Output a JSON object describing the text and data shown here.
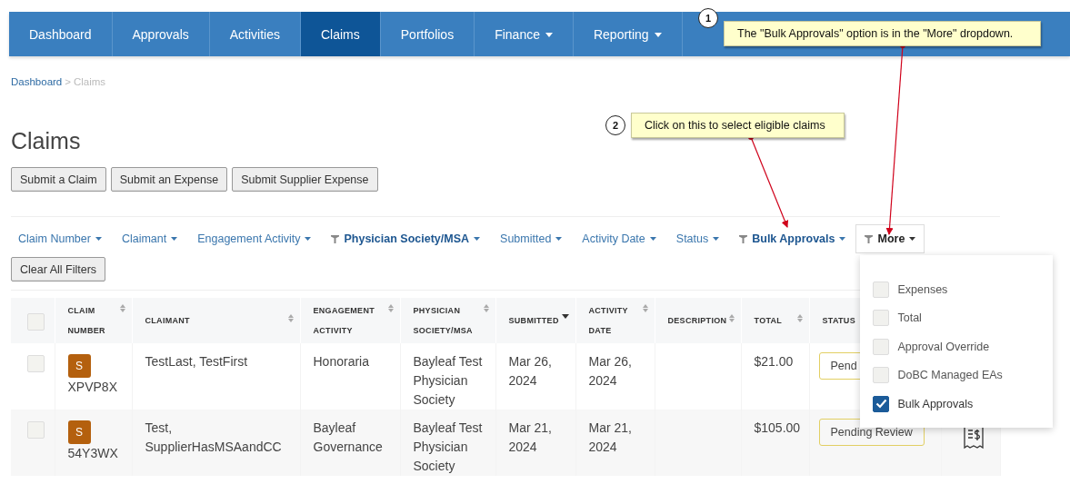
{
  "nav": {
    "items": [
      {
        "label": "Dashboard",
        "selected": false,
        "dropdown": false
      },
      {
        "label": "Approvals",
        "selected": false,
        "dropdown": false
      },
      {
        "label": "Activities",
        "selected": false,
        "dropdown": false
      },
      {
        "label": "Claims",
        "selected": true,
        "dropdown": false
      },
      {
        "label": "Portfolios",
        "selected": false,
        "dropdown": false
      },
      {
        "label": "Finance",
        "selected": false,
        "dropdown": true
      },
      {
        "label": "Reporting",
        "selected": false,
        "dropdown": true
      }
    ]
  },
  "callouts": [
    {
      "number": "1",
      "text": "The \"Bulk Approvals\" option is in the \"More\" dropdown."
    },
    {
      "number": "2",
      "text": "Click on this to select eligible claims"
    }
  ],
  "breadcrumb": {
    "items": [
      {
        "label": "Dashboard",
        "selected": false
      },
      {
        "label": "Claims",
        "selected": true
      }
    ],
    "separator": ">"
  },
  "page_title": "Claims",
  "actions": [
    "Submit a Claim",
    "Submit an Expense",
    "Submit Supplier Expense"
  ],
  "filters": [
    {
      "label": "Claim Number",
      "filtered": false,
      "open": false
    },
    {
      "label": "Claimant",
      "filtered": false,
      "open": false
    },
    {
      "label": "Engagement Activity",
      "filtered": false,
      "open": false
    },
    {
      "label": "Physician Society/MSA",
      "filtered": true,
      "open": false
    },
    {
      "label": "Submitted",
      "filtered": false,
      "open": false
    },
    {
      "label": "Activity Date",
      "filtered": false,
      "open": false
    },
    {
      "label": "Status",
      "filtered": false,
      "open": false
    },
    {
      "label": "Bulk Approvals",
      "filtered": true,
      "open": false
    },
    {
      "label": "More",
      "filtered": true,
      "open": true
    }
  ],
  "clear_filters": "Clear All Filters",
  "more_menu": [
    {
      "label": "Expenses",
      "checked": false
    },
    {
      "label": "Total",
      "checked": false
    },
    {
      "label": "Approval Override",
      "checked": false
    },
    {
      "label": "DoBC Managed EAs",
      "checked": false
    },
    {
      "label": "Bulk Approvals",
      "checked": true
    }
  ],
  "table": {
    "select_all": {
      "checked": false
    },
    "columns": [
      {
        "label": "CLAIM NUMBER",
        "sortable": true,
        "sorted": false
      },
      {
        "label": "CLAIMANT",
        "sortable": true,
        "sorted": false
      },
      {
        "label": "ENGAGEMENT ACTIVITY",
        "sortable": true,
        "sorted": false
      },
      {
        "label": "PHYSICIAN SOCIETY/MSA",
        "sortable": true,
        "sorted": false
      },
      {
        "label": "SUBMITTED",
        "sortable": true,
        "sorted": true
      },
      {
        "label": "ACTIVITY DATE",
        "sortable": true,
        "sorted": false
      },
      {
        "label": "DESCRIPTION",
        "sortable": true,
        "sorted": false
      },
      {
        "label": "TOTAL",
        "sortable": true,
        "sorted": false
      },
      {
        "label": "STATUS",
        "sortable": false
      }
    ],
    "rows": [
      {
        "selected": false,
        "badge": "S",
        "claim_number": "XPVP8X",
        "claimant": "TestLast, TestFirst",
        "activity": "Honoraria",
        "society": "Bayleaf Test Physician Society",
        "submitted": "Mar 26, 2024",
        "activity_date": "Mar 26, 2024",
        "total": "$21.00",
        "status": "Pend",
        "receipt": false
      },
      {
        "selected": false,
        "badge": "S",
        "claim_number": "54Y3WX",
        "claimant": "Test, SupplierHasMSAandCC",
        "activity": "Bayleaf Governance",
        "society": "Bayleaf Test Physician Society",
        "submitted": "Mar 21, 2024",
        "activity_date": "Mar 21, 2024",
        "total": "$105.00",
        "status": "Pending Review",
        "receipt": true
      }
    ]
  }
}
